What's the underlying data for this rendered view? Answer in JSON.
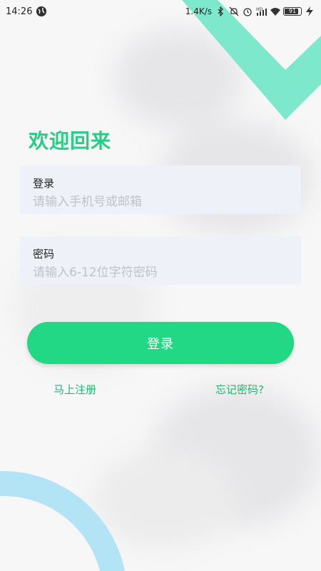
{
  "status_bar": {
    "time": "14:26",
    "network_speed": "1.4K/s",
    "battery_level": "91",
    "icons": [
      "globe-icon",
      "bluetooth-icon",
      "mute-icon",
      "alarm-icon",
      "hd-signal-icon",
      "wifi-icon",
      "battery-icon",
      "charging-icon"
    ]
  },
  "login": {
    "welcome_title": "欢迎回来",
    "account": {
      "label": "登录",
      "placeholder": "请输入手机号或邮箱"
    },
    "password": {
      "label": "密码",
      "placeholder": "请输入6-12位字符密码"
    },
    "submit_label": "登录",
    "register_link": "马上注册",
    "forgot_link": "忘记密码?"
  },
  "colors": {
    "accent": "#23d884",
    "title": "#25cd87",
    "link": "#1bb96f",
    "field_bg": "#eef1f7",
    "deco_top": "#7ee8cc",
    "deco_bottom": "#b3e4f5"
  }
}
